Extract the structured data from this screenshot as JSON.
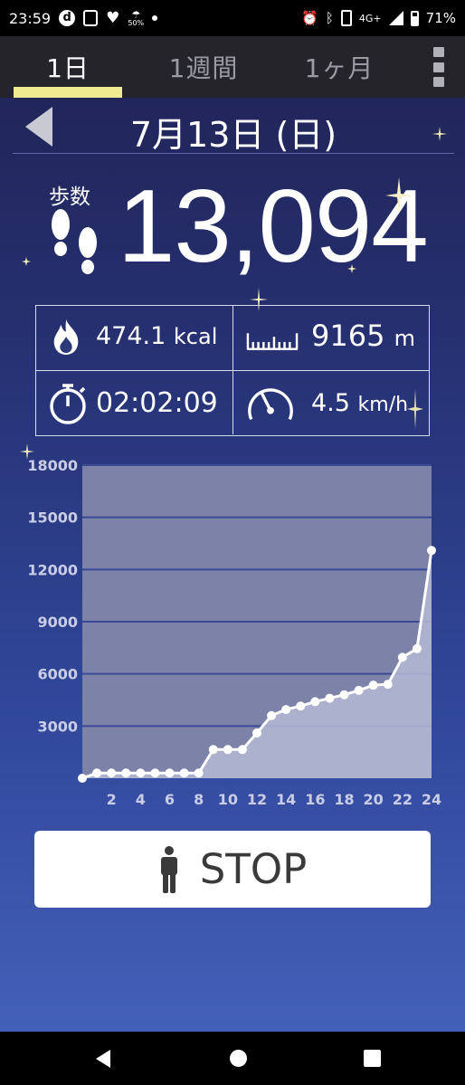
{
  "status_bar": {
    "time": "23:59",
    "weather_percent": "50%",
    "network": "4G+",
    "battery": "71%",
    "left_icons": [
      "d-app-icon",
      "shield-icon",
      "heart-icon",
      "weather-icon",
      "dot-icon"
    ],
    "right_icons": [
      "alarm-icon",
      "bluetooth-icon",
      "vibrate-icon",
      "signal-icon",
      "battery-icon"
    ]
  },
  "tabs": [
    {
      "label": "1日",
      "active": true
    },
    {
      "label": "1週間",
      "active": false
    },
    {
      "label": "1ヶ月",
      "active": false
    }
  ],
  "header": {
    "date": "7月13日 (日)"
  },
  "steps": {
    "label": "歩数",
    "value": "13,094"
  },
  "stats": {
    "calories": {
      "value": "474.1",
      "unit": "kcal",
      "icon": "flame-icon"
    },
    "distance": {
      "value": "9165",
      "unit": "m",
      "icon": "ruler-icon"
    },
    "duration": {
      "value": "02:02:09",
      "icon": "stopwatch-icon"
    },
    "speed": {
      "value": "4.5",
      "unit": "km/h",
      "icon": "speedometer-icon"
    }
  },
  "chart_data": {
    "type": "area",
    "xlabel": "",
    "ylabel": "",
    "x": [
      0,
      1,
      2,
      3,
      4,
      5,
      6,
      7,
      8,
      9,
      10,
      11,
      12,
      13,
      14,
      15,
      16,
      17,
      18,
      19,
      20,
      21,
      22,
      23,
      24
    ],
    "values": [
      0,
      300,
      300,
      300,
      300,
      300,
      300,
      300,
      300,
      1650,
      1650,
      1650,
      2600,
      3600,
      3950,
      4150,
      4400,
      4600,
      4800,
      5050,
      5350,
      5400,
      6950,
      7450,
      13094
    ],
    "xticks": [
      "2",
      "4",
      "6",
      "8",
      "10",
      "12",
      "14",
      "16",
      "18",
      "20",
      "22",
      "24"
    ],
    "yticks": [
      "3000",
      "6000",
      "9000",
      "12000",
      "15000",
      "18000"
    ],
    "ylim": [
      0,
      18000
    ],
    "xlim": [
      0,
      24
    ],
    "grid": true,
    "colors": {
      "plot_bg": "#7c82a8",
      "gridline": "#3b4a94",
      "line": "#ffffff",
      "fill": "#b5bad4",
      "tick_label": "#c9cde6"
    }
  },
  "stop_button": {
    "label": "STOP",
    "icon": "person-icon"
  },
  "nav_bar": {
    "icons": [
      "nav-back-icon",
      "nav-home-icon",
      "nav-recents-icon"
    ]
  }
}
